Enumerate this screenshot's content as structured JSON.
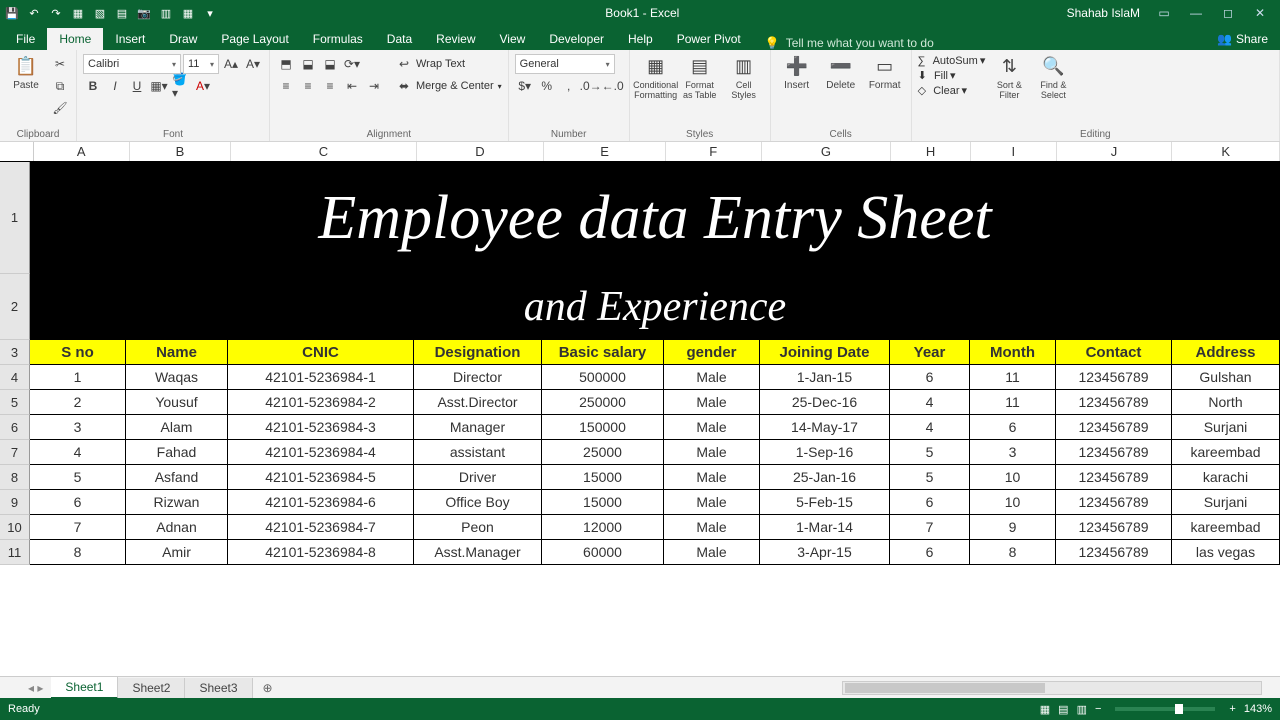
{
  "app": {
    "title": "Book1  -  Excel",
    "user": "Shahab IslaM"
  },
  "tabs": [
    "File",
    "Home",
    "Insert",
    "Draw",
    "Page Layout",
    "Formulas",
    "Data",
    "Review",
    "View",
    "Developer",
    "Help",
    "Power Pivot"
  ],
  "activeTab": "Home",
  "tell": "Tell me what you want to do",
  "share": "Share",
  "ribbon": {
    "clipboard": "Clipboard",
    "paste": "Paste",
    "font": "Font",
    "fontName": "Calibri",
    "fontSize": "11",
    "alignment": "Alignment",
    "wrap": "Wrap Text",
    "merge": "Merge & Center",
    "number": "Number",
    "numFormat": "General",
    "styles": "Styles",
    "cond": "Conditional Formatting",
    "fmtTable": "Format as Table",
    "cellStyles": "Cell Styles",
    "cells": "Cells",
    "insert": "Insert",
    "delete": "Delete",
    "format": "Format",
    "editing": "Editing",
    "autosum": "AutoSum",
    "fill": "Fill",
    "clear": "Clear",
    "sort": "Sort & Filter",
    "find": "Find & Select"
  },
  "columns": [
    "A",
    "B",
    "C",
    "D",
    "E",
    "F",
    "G",
    "H",
    "I",
    "J",
    "K"
  ],
  "title1": "Employee data Entry Sheet",
  "title2": "and Experience",
  "headers": [
    "S no",
    "Name",
    "CNIC",
    "Designation",
    "Basic salary",
    "gender",
    "Joining Date",
    "Year",
    "Month",
    "Contact",
    "Address"
  ],
  "rows": [
    [
      "1",
      "Waqas",
      "42101-5236984-1",
      "Director",
      "500000",
      "Male",
      "1-Jan-15",
      "6",
      "11",
      "123456789",
      "Gulshan"
    ],
    [
      "2",
      "Yousuf",
      "42101-5236984-2",
      "Asst.Director",
      "250000",
      "Male",
      "25-Dec-16",
      "4",
      "11",
      "123456789",
      "North"
    ],
    [
      "3",
      "Alam",
      "42101-5236984-3",
      "Manager",
      "150000",
      "Male",
      "14-May-17",
      "4",
      "6",
      "123456789",
      "Surjani"
    ],
    [
      "4",
      "Fahad",
      "42101-5236984-4",
      "assistant",
      "25000",
      "Male",
      "1-Sep-16",
      "5",
      "3",
      "123456789",
      "kareembad"
    ],
    [
      "5",
      "Asfand",
      "42101-5236984-5",
      "Driver",
      "15000",
      "Male",
      "25-Jan-16",
      "5",
      "10",
      "123456789",
      "karachi"
    ],
    [
      "6",
      "Rizwan",
      "42101-5236984-6",
      "Office Boy",
      "15000",
      "Male",
      "5-Feb-15",
      "6",
      "10",
      "123456789",
      "Surjani"
    ],
    [
      "7",
      "Adnan",
      "42101-5236984-7",
      "Peon",
      "12000",
      "Male",
      "1-Mar-14",
      "7",
      "9",
      "123456789",
      "kareembad"
    ],
    [
      "8",
      "Amir",
      "42101-5236984-8",
      "Asst.Manager",
      "60000",
      "Male",
      "3-Apr-15",
      "6",
      "8",
      "123456789",
      "las vegas"
    ]
  ],
  "rowNums": [
    "1",
    "2",
    "3",
    "4",
    "5",
    "6",
    "7",
    "8",
    "9",
    "10",
    "11"
  ],
  "sheets": [
    "Sheet1",
    "Sheet2",
    "Sheet3"
  ],
  "status": {
    "ready": "Ready",
    "zoom": "143%"
  }
}
